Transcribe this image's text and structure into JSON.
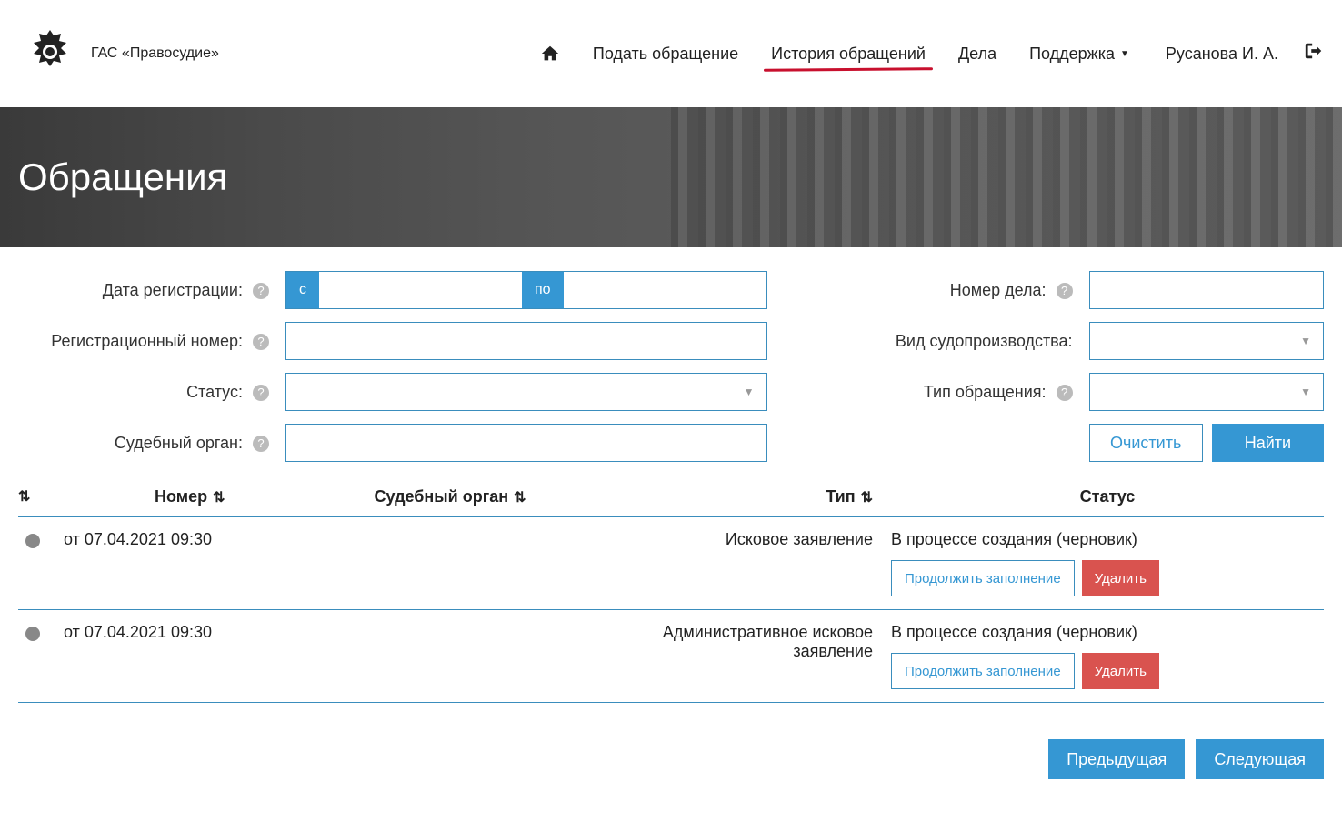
{
  "header": {
    "site_title": "ГАС «Правосудие»",
    "nav": {
      "submit": "Подать обращение",
      "history": "История обращений",
      "cases": "Дела",
      "support": "Поддержка"
    },
    "user_name": "Русанова И. А."
  },
  "banner": {
    "title": "Обращения"
  },
  "filters": {
    "reg_date_label": "Дата регистрации:",
    "reg_date_from": "с",
    "reg_date_to": "по",
    "reg_number_label": "Регистрационный номер:",
    "status_label": "Статус:",
    "court_label": "Судебный орган:",
    "case_number_label": "Номер дела:",
    "proc_type_label": "Вид судопроизводства:",
    "appeal_type_label": "Тип обращения:",
    "clear_btn": "Очистить",
    "find_btn": "Найти"
  },
  "table": {
    "headers": {
      "number": "Номер",
      "court": "Судебный орган",
      "type": "Тип",
      "status": "Статус"
    },
    "rows": [
      {
        "date": "от 07.04.2021 09:30",
        "court": "",
        "type": "Исковое заявление",
        "status": "В процессе создания (черновик)",
        "continue_btn": "Продолжить заполнение",
        "delete_btn": "Удалить"
      },
      {
        "date": "от 07.04.2021 09:30",
        "court": "",
        "type": "Административное исковое заявление",
        "status": "В процессе создания (черновик)",
        "continue_btn": "Продолжить заполнение",
        "delete_btn": "Удалить"
      }
    ]
  },
  "pagination": {
    "prev": "Предыдущая",
    "next": "Следующая"
  }
}
